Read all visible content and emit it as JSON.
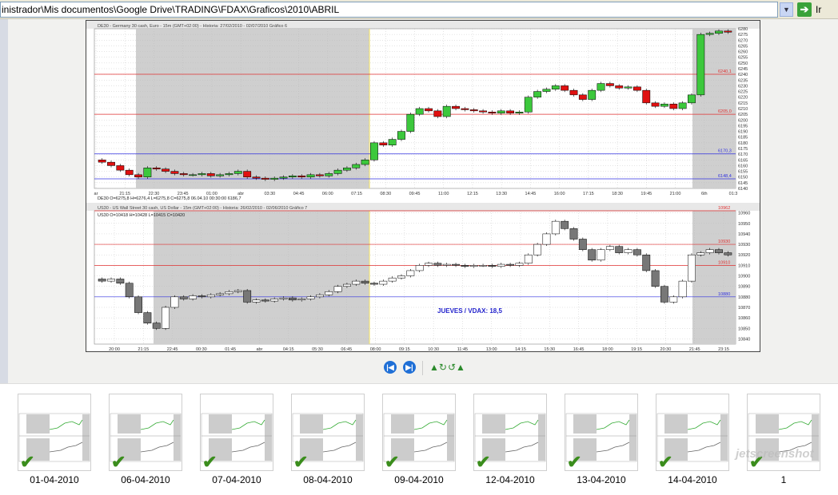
{
  "address": {
    "path": "inistrador\\Mis documentos\\Google Drive\\TRADING\\FDAX\\Graficos\\2010\\ABRIL",
    "go_label": "Ir",
    "dropdown_icon": "chevron-down-icon",
    "go_icon": "arrow-right-icon"
  },
  "chart_top": {
    "title": "DE30 - Germany 30 cash, Euro - 15m (GMT+02:00) - Historia: 27/02/2010 - 02/07/2010  Gráfico 6",
    "status": "DE30 O=6275,8 H=6276,4 L=6275,8 C=6275,8   06.04.10 00:30:00 6186,7",
    "ylim": [
      6140,
      6280
    ],
    "yticks": [
      6280,
      6275,
      6270,
      6265,
      6260,
      6255,
      6250,
      6245,
      6240,
      6235,
      6230,
      6225,
      6220,
      6215,
      6210,
      6205,
      6200,
      6195,
      6190,
      6185,
      6180,
      6175,
      6170,
      6165,
      6160,
      6155,
      6150,
      6145,
      6140
    ],
    "xticks": [
      "ar",
      "21:15",
      "22:30",
      "23:45",
      "01:00",
      "abr",
      "03:30",
      "04:45",
      "06:00",
      "07:15",
      "08:30",
      "09:45",
      "11:00",
      "12:15",
      "13:30",
      "14:45",
      "16:00",
      "17:15",
      "18:30",
      "19:45",
      "21:00",
      "6th",
      "01:3"
    ],
    "levels": [
      {
        "value": 6240.1,
        "label": "6240,1",
        "color": "#e03030"
      },
      {
        "value": 6205.0,
        "label": "6205,0",
        "color": "#e03030"
      },
      {
        "value": 6170.3,
        "label": "6170,3",
        "color": "#3030e0"
      },
      {
        "value": 6148.4,
        "label": "6148,4",
        "color": "#3030e0"
      }
    ],
    "up_color": "#3cc83c",
    "down_color": "#e01010",
    "closes": [
      6163,
      6160,
      6156,
      6152,
      6150,
      6158,
      6157,
      6155,
      6153,
      6152,
      6152,
      6153,
      6151,
      6152,
      6153,
      6155,
      6150,
      6149,
      6148,
      6149,
      6150,
      6151,
      6150,
      6152,
      6151,
      6153,
      6156,
      6158,
      6161,
      6165,
      6180,
      6178,
      6183,
      6190,
      6205,
      6210,
      6208,
      6203,
      6212,
      6210,
      6209,
      6208,
      6207,
      6206,
      6208,
      6206,
      6207,
      6220,
      6225,
      6227,
      6230,
      6226,
      6222,
      6218,
      6226,
      6232,
      6230,
      6228,
      6229,
      6226,
      6215,
      6212,
      6214,
      6210,
      6215,
      6222,
      6275,
      6276,
      6278,
      6277
    ]
  },
  "chart_bottom": {
    "title": "US30 - US Wall Street 30 cash, US Dollar - 15m (GMT+02:00) - Historia: 26/02/2010 - 02/06/2010  Gráfico 7",
    "status": "US30 O=10418 H=10428 L=10415 C=10420",
    "annotation": "JUEVES / VDAX: 18,5",
    "ylim": [
      10835,
      10962
    ],
    "yticks": [
      10960,
      10950,
      10940,
      10930,
      10920,
      10910,
      10900,
      10890,
      10880,
      10870,
      10860,
      10850,
      10840
    ],
    "xticks": [
      "20:00",
      "21:15",
      "22:45",
      "00:30",
      "01:45",
      "abr",
      "04:15",
      "05:30",
      "06:45",
      "08:00",
      "09:15",
      "10:30",
      "11:45",
      "13:00",
      "14:15",
      "15:30",
      "16:45",
      "18:00",
      "19:15",
      "20:30",
      "21:45",
      "23:15"
    ],
    "levels": [
      {
        "value": 10962,
        "label": "10962",
        "color": "#e03030"
      },
      {
        "value": 10930,
        "label": "10930",
        "color": "#e03030"
      },
      {
        "value": 10910,
        "label": "10910",
        "color": "#e03030"
      },
      {
        "value": 10880,
        "label": "10880",
        "color": "#3030e0"
      }
    ],
    "up_color": "#ffffff",
    "down_color": "#777777",
    "closes": [
      10895,
      10897,
      10893,
      10880,
      10865,
      10855,
      10850,
      10870,
      10880,
      10878,
      10881,
      10880,
      10882,
      10883,
      10885,
      10886,
      10875,
      10877,
      10876,
      10878,
      10879,
      10877,
      10878,
      10880,
      10882,
      10885,
      10890,
      10892,
      10895,
      10893,
      10892,
      10895,
      10898,
      10900,
      10905,
      10910,
      10912,
      10910,
      10911,
      10910,
      10909,
      10910,
      10910,
      10909,
      10911,
      10910,
      10912,
      10920,
      10930,
      10940,
      10952,
      10945,
      10935,
      10925,
      10915,
      10925,
      10928,
      10922,
      10925,
      10920,
      10905,
      10890,
      10875,
      10880,
      10895,
      10920,
      10922,
      10925,
      10922,
      10920
    ]
  },
  "nav": {
    "prev_icon": "previous-image-icon",
    "next_icon": "next-image-icon",
    "rotate_cw_icon": "rotate-clockwise-icon",
    "rotate_ccw_icon": "rotate-counterclockwise-icon"
  },
  "thumbnails": [
    {
      "label": "01-04-2010"
    },
    {
      "label": "06-04-2010"
    },
    {
      "label": "07-04-2010"
    },
    {
      "label": "08-04-2010"
    },
    {
      "label": "09-04-2010"
    },
    {
      "label": "12-04-2010"
    },
    {
      "label": "13-04-2010"
    },
    {
      "label": "14-04-2010"
    },
    {
      "label": "1"
    }
  ],
  "watermark": "jetscreenshot"
}
